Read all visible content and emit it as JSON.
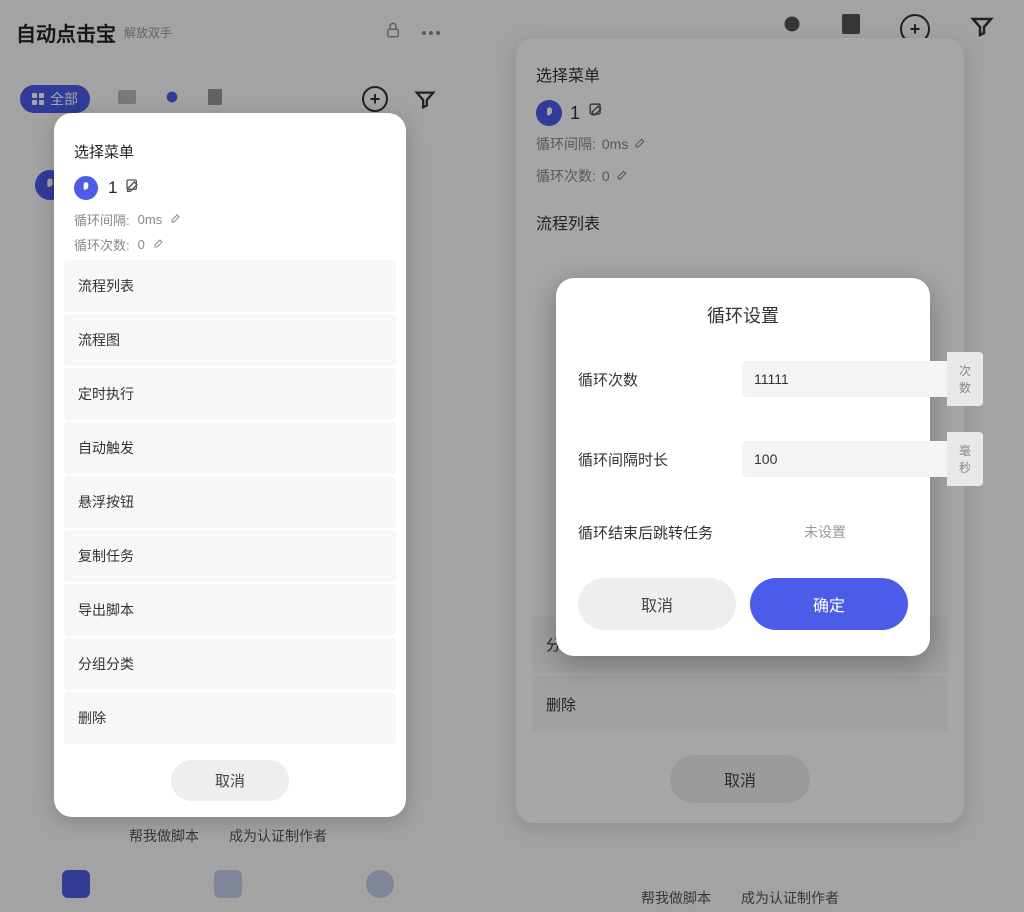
{
  "left": {
    "app_title": "自动点击宝",
    "app_subtitle": "解放双手",
    "tab_all": "全部",
    "modal": {
      "title": "选择菜单",
      "number": "1",
      "interval_label": "循环间隔:",
      "interval_value": "0ms",
      "count_label": "循环次数:",
      "count_value": "0",
      "items": [
        "流程列表",
        "流程图",
        "定时执行",
        "自动触发",
        "悬浮按钮",
        "复制任务",
        "导出脚本",
        "分组分类",
        "删除"
      ],
      "cancel": "取消"
    },
    "bottom_link1": "帮我做脚本",
    "bottom_link2": "成为认证制作者"
  },
  "right": {
    "bg_modal": {
      "title": "选择菜单",
      "number": "1",
      "interval_label": "循环间隔:",
      "interval_value": "0ms",
      "count_label": "循环次数:",
      "count_value": "0",
      "section_label": "流程列表",
      "item_group": "分组分类",
      "item_delete": "删除",
      "cancel": "取消"
    },
    "loop_modal": {
      "title": "循环设置",
      "row1_label": "循环次数",
      "row1_value": "11111",
      "row1_unit": "次数",
      "row2_label": "循环间隔时长",
      "row2_value": "100",
      "row2_unit": "毫秒",
      "row3_label": "循环结束后跳转任务",
      "row3_value": "未设置",
      "cancel": "取消",
      "confirm": "确定"
    },
    "bottom_link1": "帮我做脚本",
    "bottom_link2": "成为认证制作者"
  }
}
